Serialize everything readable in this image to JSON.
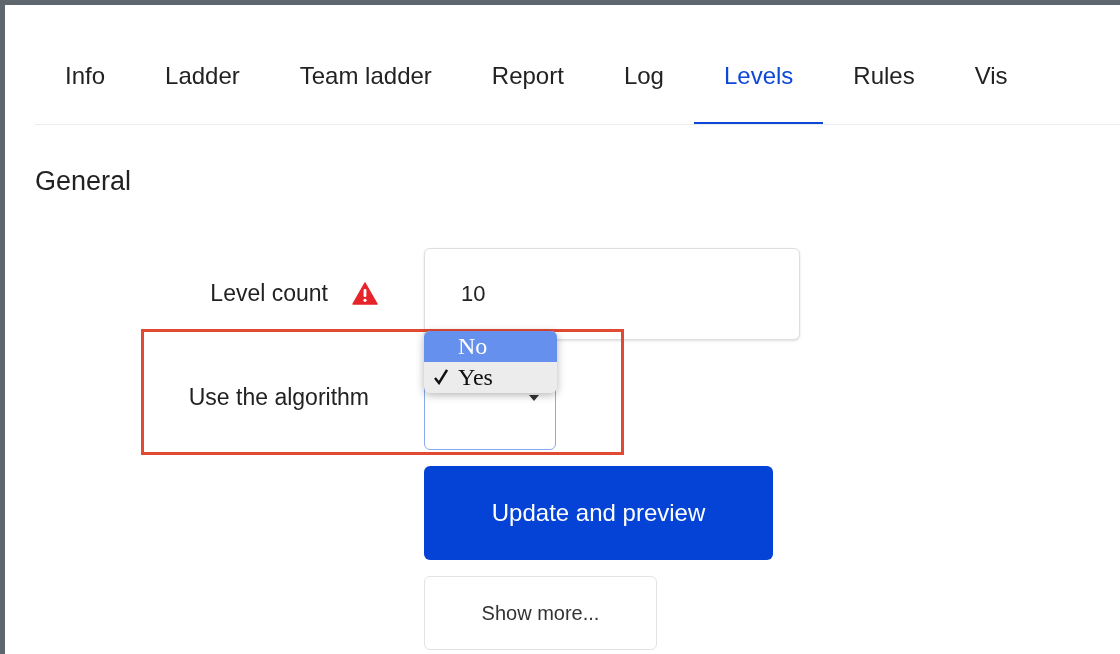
{
  "tabs": [
    {
      "label": "Info",
      "selected": false
    },
    {
      "label": "Ladder",
      "selected": false
    },
    {
      "label": "Team ladder",
      "selected": false
    },
    {
      "label": "Report",
      "selected": false
    },
    {
      "label": "Log",
      "selected": false
    },
    {
      "label": "Levels",
      "selected": true
    },
    {
      "label": "Rules",
      "selected": false
    },
    {
      "label": "Vis",
      "selected": false
    }
  ],
  "section_title": "General",
  "fields": [
    {
      "kind": "text",
      "label": "Level count",
      "warning": true,
      "value": "10"
    },
    {
      "kind": "select",
      "label": "Use the algorithm",
      "warning": false,
      "options": [
        {
          "label": "No",
          "selected": false,
          "highlighted": true
        },
        {
          "label": "Yes",
          "selected": true,
          "highlighted": false
        }
      ]
    }
  ],
  "buttons": [
    {
      "kind": "primary",
      "label": "Update and preview"
    },
    {
      "kind": "secondary",
      "label": "Show more..."
    }
  ],
  "annotation": {
    "kind": "highlight-box",
    "color": "#e04a33"
  }
}
